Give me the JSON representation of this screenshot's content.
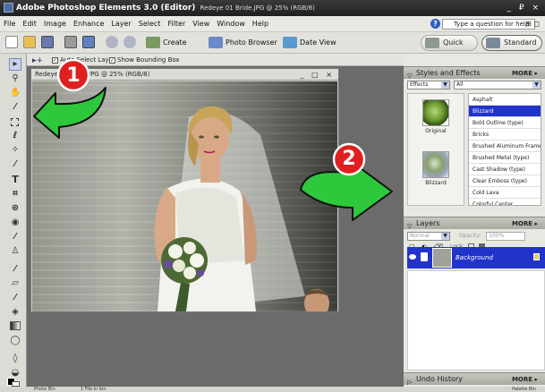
{
  "app": {
    "title": "Adobe Photoshop Elements 3.0 (Editor)",
    "document_info": "Redeye 01 Bride.JPG @ 25% (RGB/8)",
    "window_controls": "_ ₽ ×"
  },
  "menu": {
    "items": [
      "File",
      "Edit",
      "Image",
      "Enhance",
      "Layer",
      "Select",
      "Filter",
      "View",
      "Window",
      "Help"
    ],
    "help_placeholder": "Type a question for help",
    "help_icon": "?",
    "right_text": "⊞ ◻"
  },
  "toolbar": {
    "create_label": "Create",
    "photo_browser_label": "Photo Browser",
    "date_view_label": "Date View",
    "quick_fix_label": "Quick Fix",
    "standard_edit_label": "Standard Edit"
  },
  "options": {
    "auto_select_label": "Auto Select Layer",
    "show_bounding_label": "Show Bounding Box"
  },
  "document": {
    "tab_title": "Redeye 01 Bride.JPG @ 25% (RGB/8)",
    "controls": "_ □ ×"
  },
  "callouts": {
    "badge_1": "1",
    "badge_2": "2"
  },
  "styles_panel": {
    "title": "Styles and Effects",
    "more": "MORE ▸",
    "category": "Effects",
    "filter": "All",
    "thumbs": [
      {
        "label": "Original"
      },
      {
        "label": "Blizzard"
      }
    ],
    "effects": [
      "Asphalt",
      "Blizzard",
      "Bold Outline (type)",
      "Bricks",
      "Brushed Aluminum Frame",
      "Brushed Metal (type)",
      "Cast Shadow (type)",
      "Clear Emboss (type)",
      "Cold Lava",
      "Colorful Center"
    ],
    "selected_effect": "Blizzard"
  },
  "layers_panel": {
    "title": "Layers",
    "more": "MORE ▸",
    "blend_mode": "Normal",
    "opacity_label": "Opacity:",
    "opacity_value": "100%",
    "lock_label": "Lock:",
    "layer_name": "Background"
  },
  "undo_panel": {
    "title": "Undo History",
    "more": "MORE ▸"
  },
  "status": {
    "photo_bin": "Photo Bin",
    "file_count": "1 File in bin",
    "palette_bin": "Palette Bin"
  },
  "colors": {
    "accent": "#2233cc",
    "badge_red": "#e02020",
    "arrow_green": "#2ec83c"
  }
}
